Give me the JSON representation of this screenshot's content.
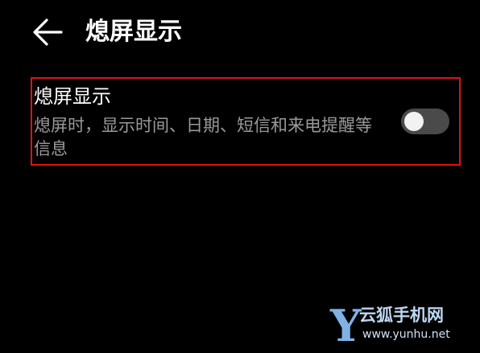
{
  "header": {
    "back_icon": "arrow-left-icon",
    "title": "熄屏显示"
  },
  "setting": {
    "title": "熄屏显示",
    "description": "熄屏时，显示时间、日期、短信和来电提醒等信息",
    "toggle_on": false,
    "toggle_track_color": "#4a4a4a",
    "highlight_color": "#e0101c"
  },
  "watermark": {
    "logo_letter": "Y",
    "name": "云狐手机网",
    "url": "www.yunhu.net"
  }
}
